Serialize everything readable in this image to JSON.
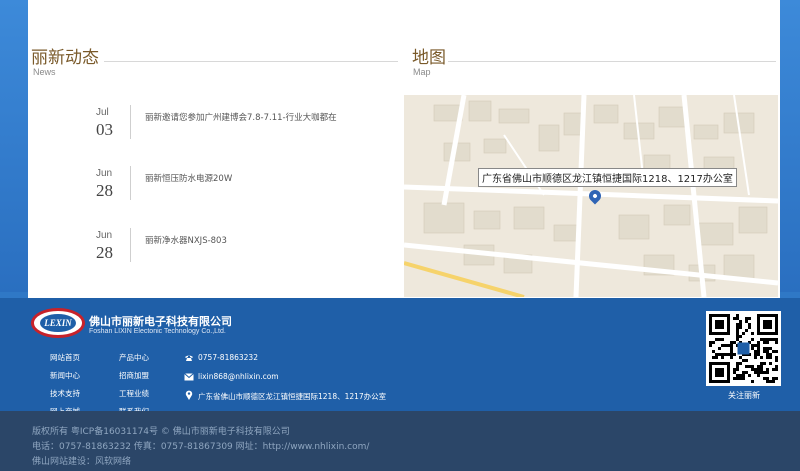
{
  "news_section": {
    "title": "丽新动态",
    "subtitle": "News",
    "items": [
      {
        "month": "Jul",
        "day": "03",
        "text": "丽新邀请您参加广州建博会7.8-7.11-行业大咖都在"
      },
      {
        "month": "Jun",
        "day": "28",
        "text": "丽新恒压防水电源20W"
      },
      {
        "month": "Jun",
        "day": "28",
        "text": "丽新净水器NXJS-803"
      }
    ]
  },
  "map_section": {
    "title": "地图",
    "subtitle": "Map",
    "map_label": "广东省佛山市顺德区龙江镇恒捷国际1218、1217办公室"
  },
  "footer": {
    "logo_text": "LEXIN",
    "company_cn": "佛山市丽新电子科技有限公司",
    "company_en": "Foshan LIXIN Electonic Technology Co.,Ltd.",
    "links": [
      "网站首页",
      "产品中心",
      "新闻中心",
      "招商加盟",
      "技术支持",
      "工程业绩",
      "网上商城",
      "联系我们"
    ],
    "phone": "0757-81863232",
    "email": "lixin868@nhlixin.com",
    "address": "广东省佛山市顺德区龙江镇恒捷国际1218、1217办公室",
    "qr_label": "关注丽新"
  },
  "bottom_bar": {
    "line1": "版权所有  粤ICP备16031174号  © 佛山市丽新电子科技有限公司",
    "line2": "电话：0757-81863232  传真：0757-81867309  网址：http://www.nhlixin.com/",
    "line3": "佛山网站建设：风软网络"
  },
  "colors": {
    "top_band": "#3d8ad9",
    "footer": "#1f5fa8",
    "bottom_bar": "#2b4668",
    "section_title": "#7a5a2a",
    "map_pin": "#2f64b5"
  }
}
